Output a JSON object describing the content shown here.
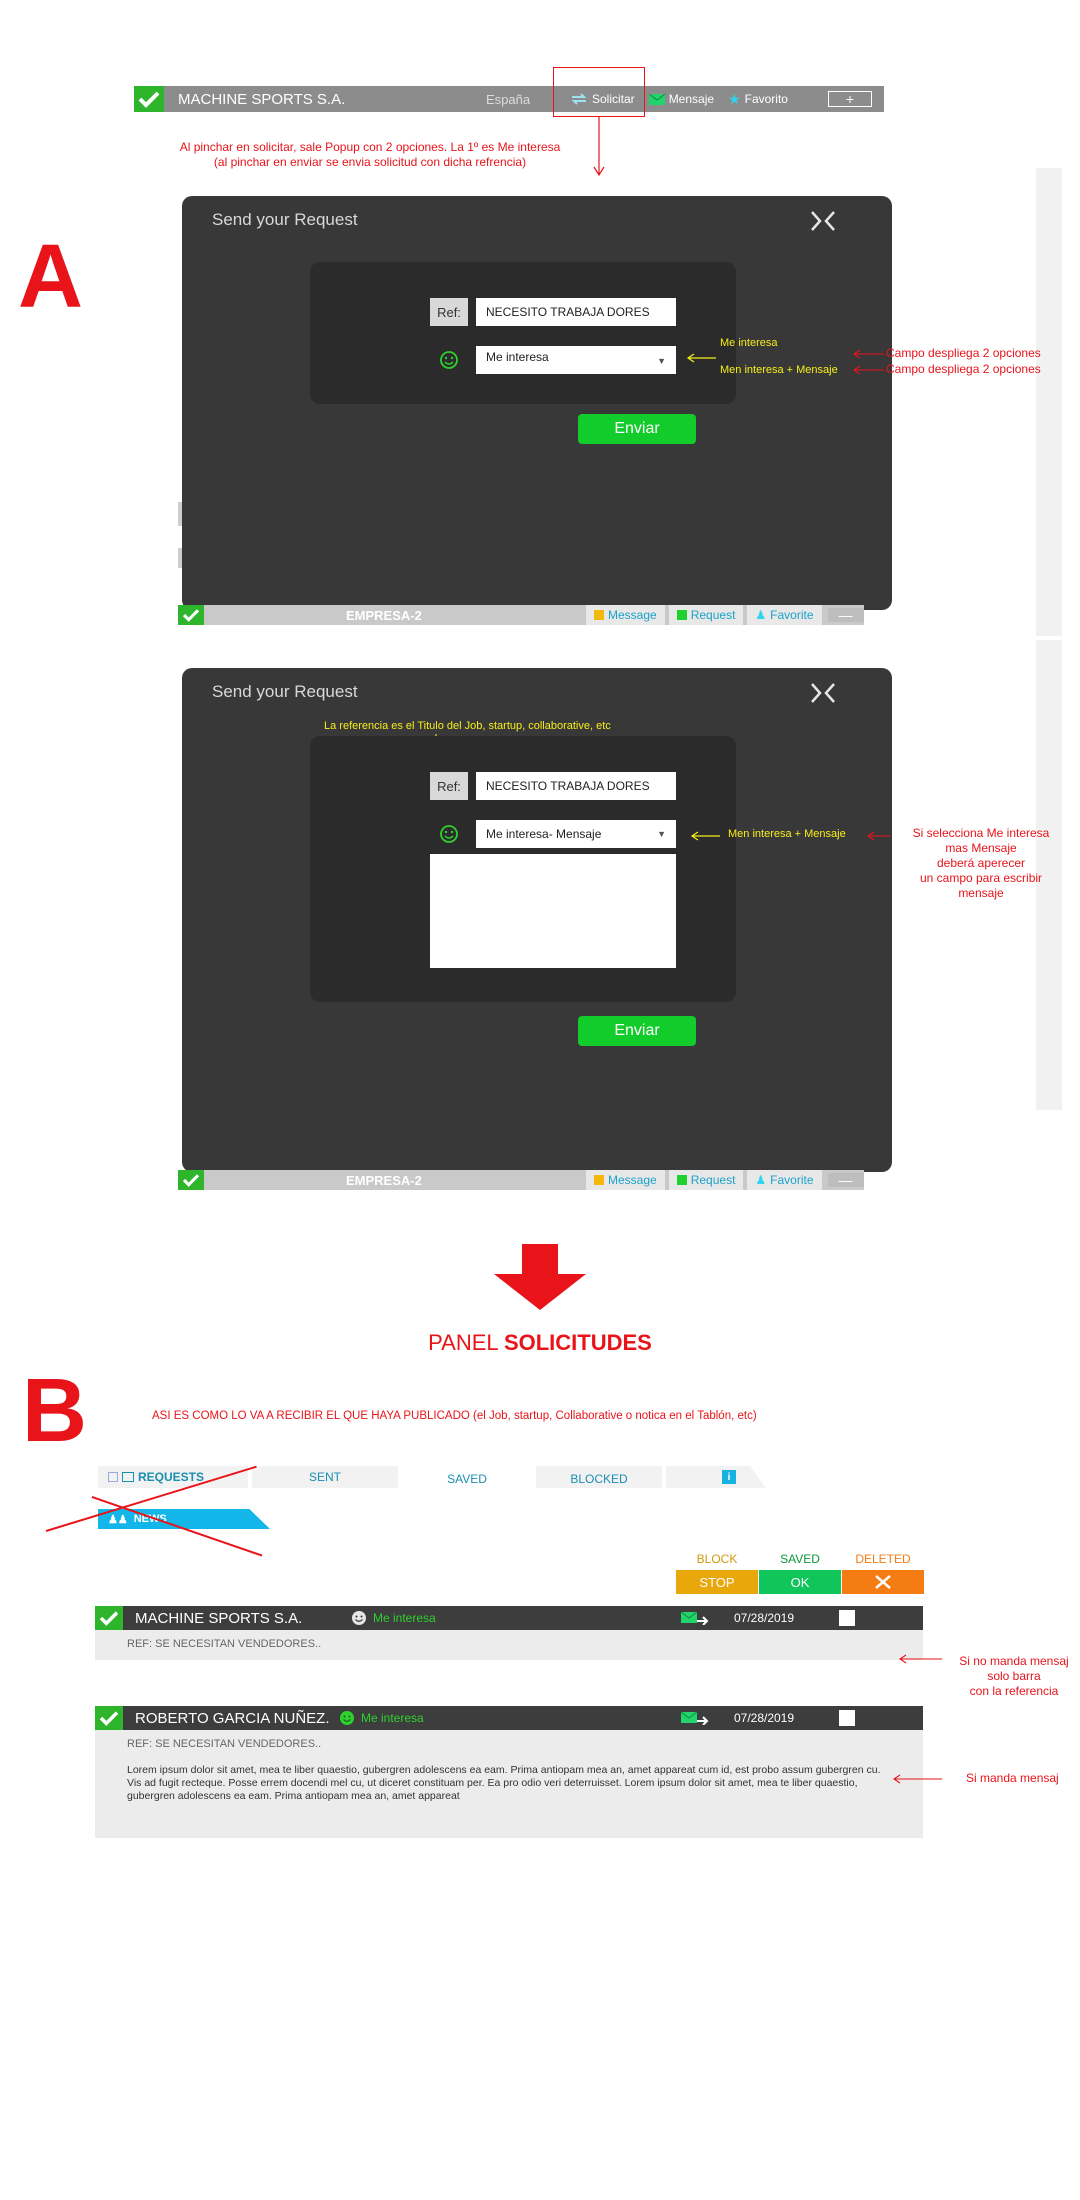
{
  "top_bar": {
    "company": "MACHINE SPORTS S.A.",
    "country": "España",
    "solicitar": "Solicitar",
    "mensaje": "Mensaje",
    "favorito": "Favorito",
    "plus": "+"
  },
  "note_top": {
    "line1": "Al pinchar en solicitar, sale Popup con 2 opciones. La 1º es Me interesa",
    "line2": "(al pinchar en enviar se envia solicitud con dicha refrencia)"
  },
  "letters": {
    "a": "A",
    "b": "B"
  },
  "ghost": {
    "company": "EMPRESA-2",
    "message": "Message",
    "request": "Request",
    "favorite": "Favorite",
    "minus": "—"
  },
  "modal1": {
    "title": "Send your Request",
    "ref_label": "Ref:",
    "ref_value": "NECESITO TRABAJA DORES",
    "select_value": "Me interesa",
    "send": "Enviar",
    "opt1": "Me interesa",
    "opt2": "Men interesa + Mensaje",
    "note1": "Campo despliega 2 opciones",
    "note2": "Campo despliega 2 opciones"
  },
  "modal2": {
    "title": "Send your Request",
    "ref_note": "La referencia es el Titulo del Job, startup, collaborative, etc",
    "ref_label": "Ref:",
    "ref_value": "NECESITO TRABAJA DORES",
    "select_value": "Me interesa- Mensaje",
    "send": "Enviar",
    "opt": "Men interesa + Mensaje",
    "note_lines": [
      "Si selecciona Me interesa",
      "mas Mensaje",
      "deberá aperecer",
      "un campo para escribir",
      "mensaje"
    ]
  },
  "panel": {
    "title_a": "PANEL ",
    "title_b": "SOLICITUDES",
    "subtitle": "ASI ES COMO LO VA A RECIBIR EL QUE HAYA PUBLICADO (el Job, startup, Collaborative o notica en el Tablón, etc)",
    "tabs": [
      "REQUESTS",
      "SENT",
      "SAVED",
      "BLOCKED"
    ],
    "news": "NEWS",
    "legend": [
      {
        "label": "BLOCK",
        "button": "STOP",
        "color": "#e8a80c"
      },
      {
        "label": "SAVED",
        "button": "OK",
        "color": "#10c55a"
      },
      {
        "label": "DELETED",
        "button": "",
        "color": "#f57c12"
      }
    ],
    "messages": [
      {
        "name": "MACHINE SPORTS S.A.",
        "interest": "Me interesa",
        "date": "07/28/2019",
        "ref": "REF: SE NECESITAN VENDEDORES..",
        "body": "",
        "note": [
          "Si no manda mensaj",
          "solo barra",
          "con la referencia"
        ]
      },
      {
        "name": "ROBERTO GARCIA NUÑEZ.",
        "interest": "Me interesa",
        "date": "07/28/2019",
        "ref": "REF: SE NECESITAN VENDEDORES..",
        "body": "Lorem ipsum dolor sit amet, mea te liber quaestio, gubergren adolescens ea eam. Prima antiopam mea an, amet appareat  cum id, est probo assum gubergren cu. Vis ad fugit recteque. Posse errem docendi mel cu, ut diceret constituam per. Ea pro odio veri  deterruisset. Lorem ipsum dolor sit amet, mea te liber quaestio, gubergren adolescens ea eam. Prima antiopam mea an, amet appareat",
        "note": [
          "Si manda mensaj"
        ]
      }
    ]
  }
}
